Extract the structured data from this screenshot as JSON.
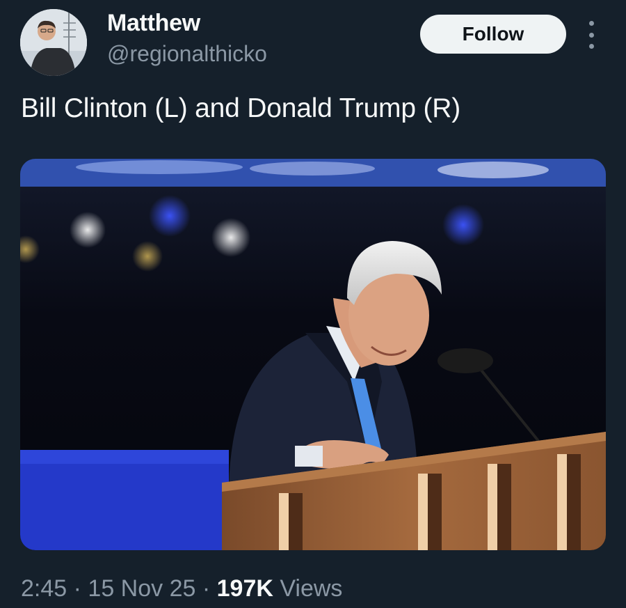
{
  "user": {
    "display_name": "Matthew",
    "handle": "@regionalthicko",
    "avatar_icon": "user-avatar"
  },
  "actions": {
    "follow_label": "Follow",
    "more_icon": "more-vertical-icon"
  },
  "tweet": {
    "text": "Bill Clinton (L) and Donald Trump (R)",
    "media_icon": "photo-image"
  },
  "meta": {
    "time": "2:45",
    "separator": " · ",
    "date": "15 Nov 25",
    "views_count": "197K",
    "views_label": " Views"
  },
  "colors": {
    "background": "#15202b",
    "primary_text": "#f7f9f9",
    "secondary_text": "#8b98a5",
    "button_bg": "#eff3f4"
  }
}
